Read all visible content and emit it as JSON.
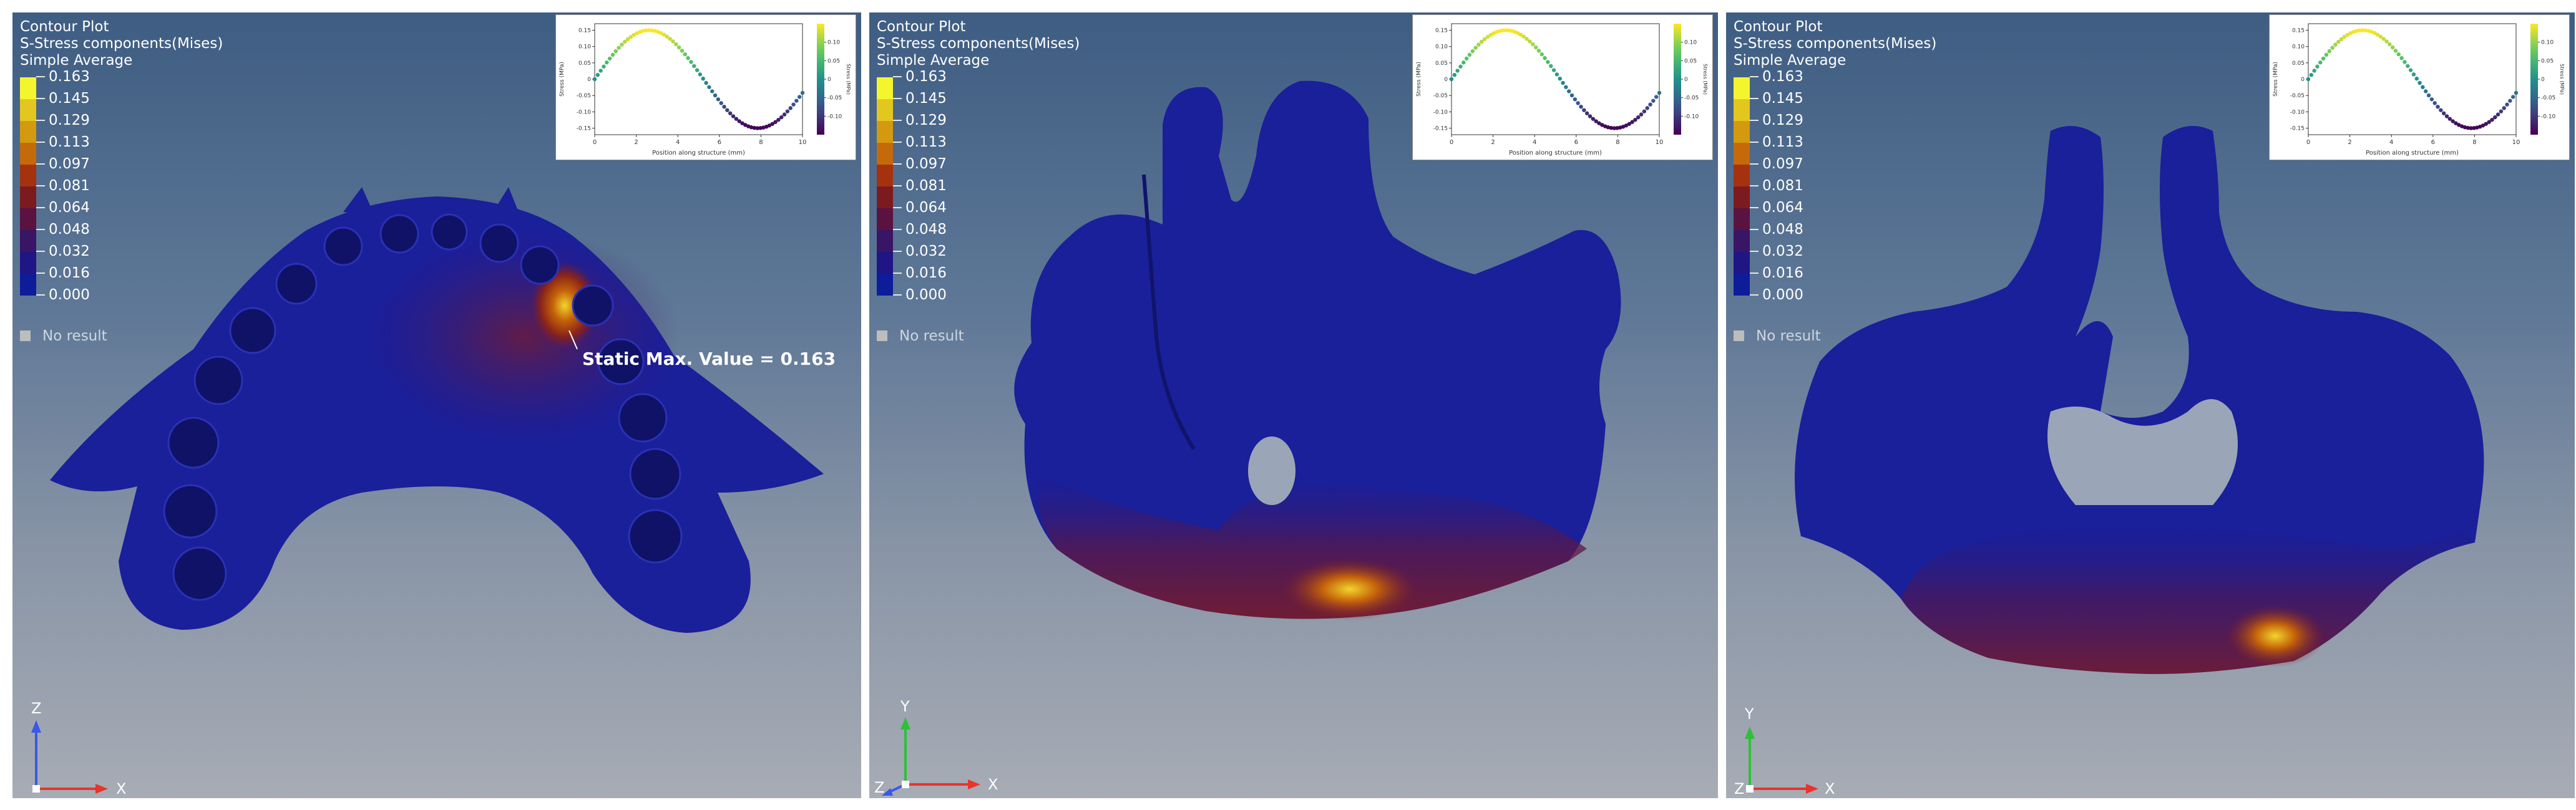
{
  "title_lines": [
    "Contour Plot",
    "S-Stress components(Mises)",
    "Simple Average"
  ],
  "legend": {
    "values": [
      "0.163",
      "0.145",
      "0.129",
      "0.113",
      "0.097",
      "0.081",
      "0.064",
      "0.048",
      "0.032",
      "0.016",
      "0.000"
    ],
    "colors": [
      "#f5f52e",
      "#e3c71f",
      "#d49a0f",
      "#c46a0a",
      "#a5320e",
      "#7c1b1f",
      "#5a1340",
      "#391565",
      "#201585",
      "#0d1d99"
    ],
    "no_result_label": "No result",
    "no_result_color": "#bdbdbd"
  },
  "inset_chart": {
    "chart_data": {
      "type": "scatter",
      "xlabel": "Position along structure (mm)",
      "ylabel": "Stress (MPa)",
      "colorbar_label": "Stress (MPa)",
      "xlim": [
        0,
        10
      ],
      "ylim": [
        -0.17,
        0.17
      ],
      "x_ticks": [
        0,
        2,
        4,
        6,
        8,
        10
      ],
      "y_ticks": [
        -0.15,
        -0.1,
        -0.05,
        0.0,
        0.05,
        0.1,
        0.15
      ],
      "colorbar_ticks": [
        0.1,
        0.05,
        0.0,
        -0.05,
        -0.1
      ],
      "series_formula": "y = 0.15 * sin(0.6 * x)",
      "x_start": 0,
      "x_end": 10,
      "points": 70,
      "colormap": "viridis",
      "grid": false
    }
  },
  "viewports": [
    {
      "id": "top-view",
      "vertical_axis": "Z",
      "horizontal_axis": "X",
      "static_max_text": "Static Max. Value =  0.163"
    },
    {
      "id": "front-oblique-view",
      "vertical_axis": "Y",
      "horizontal_axis": "X",
      "depth_axis": "Z"
    },
    {
      "id": "front-view",
      "vertical_axis": "Y",
      "horizontal_axis": "X",
      "depth_axis": "Z"
    }
  ],
  "colors": {
    "model_blue": "#1a1f9a",
    "model_blue_dark": "#0f1266",
    "stress_mid": "#6a1a3e",
    "stress_hot": "#c4620a",
    "stress_peak": "#f2d52c",
    "axis_x": "#e8342c",
    "axis_y": "#2fbf3a",
    "axis_z": "#3a57e8"
  }
}
